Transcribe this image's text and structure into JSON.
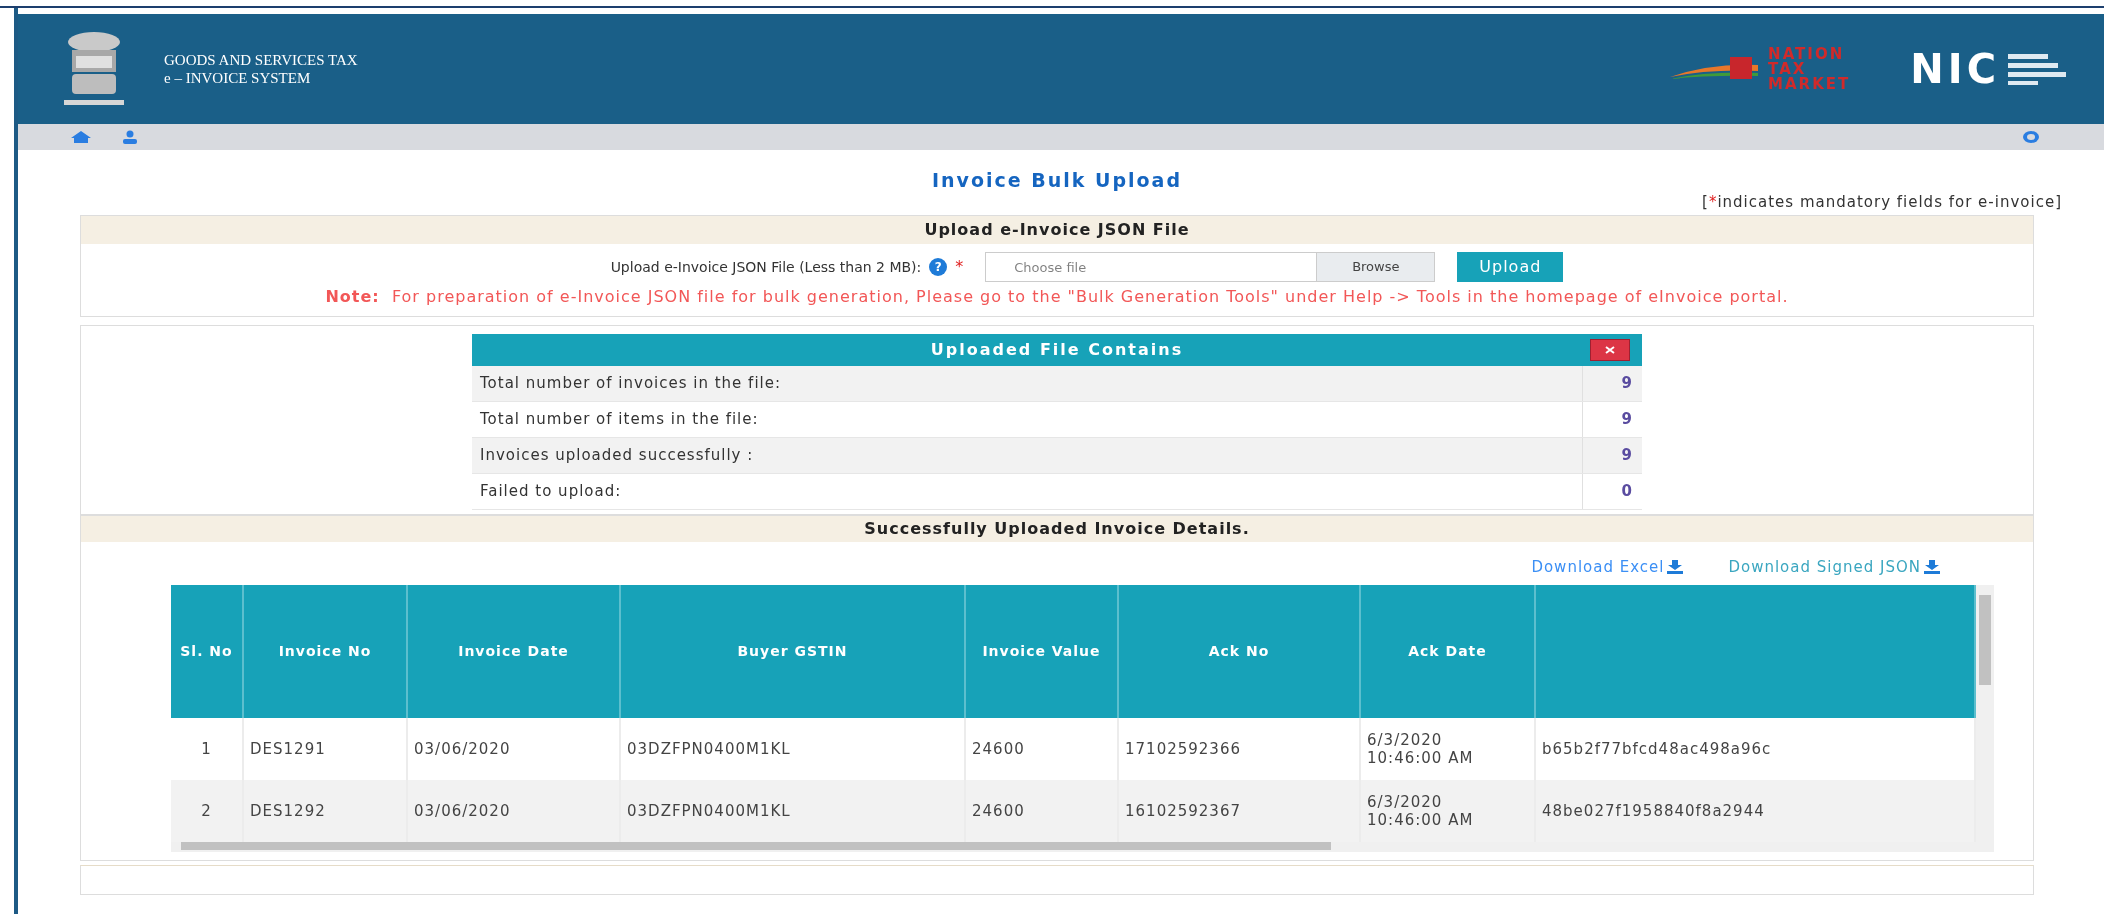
{
  "header": {
    "title_line_1": "GOODS AND SERVICES TAX",
    "title_line_2": "e – INVOICE SYSTEM",
    "partner_logo": [
      "NATION",
      "TAX",
      "MARKET"
    ],
    "nic_logo": "NIC"
  },
  "page_title": "Invoice Bulk Upload",
  "mandatory_note": {
    "open": "[",
    "mark": "*",
    "text": "indicates mandatory fields for e-invoice]"
  },
  "upload_section": {
    "title": "Upload e-Invoice JSON File",
    "field_label": "Upload e-Invoice JSON File (Less than 2 MB):",
    "help": "?",
    "required_mark": "*",
    "file_placeholder": "Choose file",
    "browse": "Browse",
    "upload_button": "Upload",
    "note_label": "Note:",
    "note": "For preparation of e-Invoice JSON file for bulk generation, Please go to the \"Bulk Generation Tools\" under Help -> Tools in the homepage of eInvoice portal."
  },
  "summary": {
    "title": "Uploaded File Contains",
    "rows": [
      {
        "label": "Total number of invoices in the file:",
        "value": "9"
      },
      {
        "label": "Total number of items in the file:",
        "value": "9"
      },
      {
        "label": "Invoices uploaded successfully :",
        "value": "9"
      },
      {
        "label": "Failed to upload:",
        "value": "0"
      }
    ]
  },
  "details": {
    "title": "Successfully Uploaded Invoice Details.",
    "links": [
      "Download Excel",
      "Download Signed JSON"
    ],
    "columns": [
      "Sl. No",
      "Invoice No",
      "Invoice Date",
      "Buyer GSTIN",
      "Invoice Value",
      "Ack No",
      "Ack Date",
      ""
    ],
    "rows": [
      [
        "1",
        "DES1291",
        "03/06/2020",
        "03DZFPN0400M1KL",
        "24600",
        "17102592366",
        "6/3/2020 10:46:00 AM",
        "b65b2f77bfcd48ac498a96c"
      ],
      [
        "2",
        "DES1292",
        "03/06/2020",
        "03DZFPN0400M1KL",
        "24600",
        "16102592367",
        "6/3/2020 10:46:00 AM",
        "48be027f1958840f8a2944"
      ]
    ]
  }
}
